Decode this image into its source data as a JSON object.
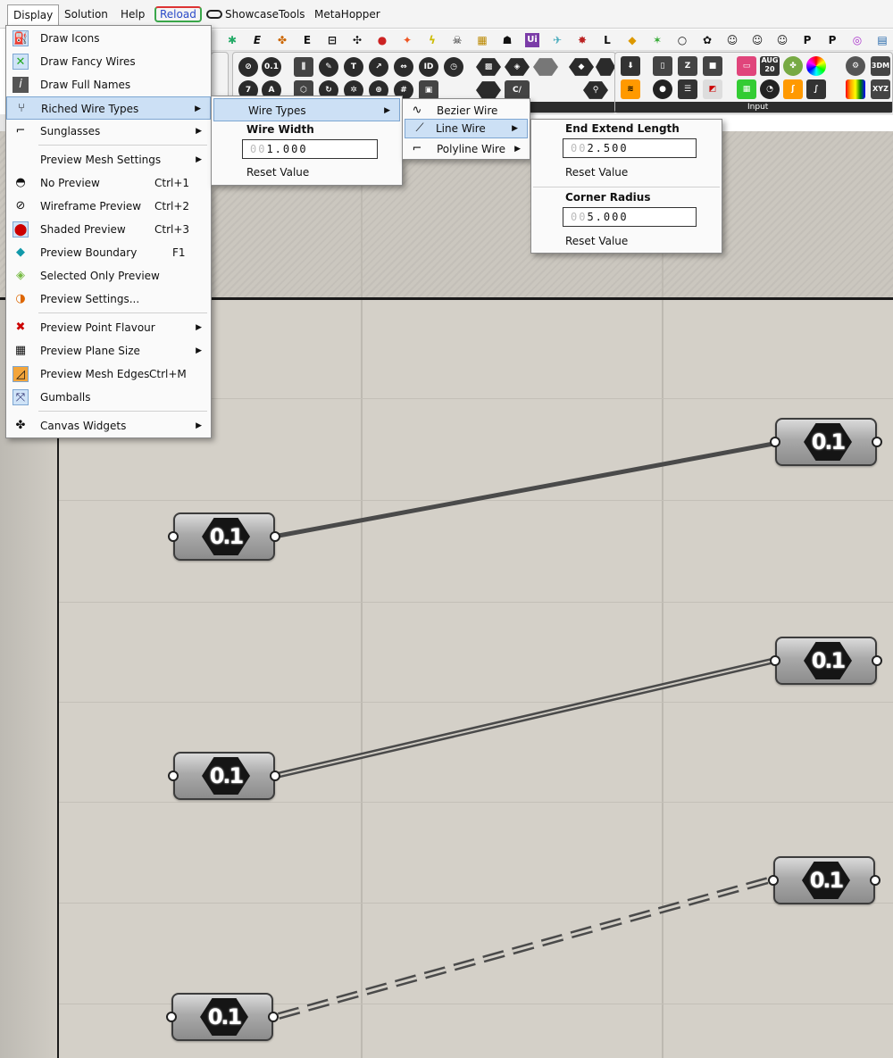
{
  "menubar": {
    "display": "Display",
    "solution": "Solution",
    "help": "Help",
    "reload": "Reload",
    "showcase": "ShowcaseTools",
    "metahopper": "MetaHopper"
  },
  "ribbon": {
    "input_label": "Input",
    "icon_labels": {
      "zero_one": "0.1",
      "seven": "7",
      "a": "A",
      "id": "ID",
      "c": "C/",
      "aug": "AUG",
      "twenty": "20",
      "three_dm": "3DM",
      "xyz": "XYZ",
      "ui": "Ui",
      "e": "E",
      "l": "L",
      "p": "P"
    }
  },
  "display_menu": {
    "items": [
      {
        "label": "Draw Icons"
      },
      {
        "label": "Draw Fancy Wires"
      },
      {
        "label": "Draw Full Names"
      },
      {
        "label": "Riched Wire Types"
      },
      {
        "label": "Sunglasses"
      },
      {
        "label": "Preview Mesh Settings"
      },
      {
        "label": "No Preview",
        "shortcut": "Ctrl+1"
      },
      {
        "label": "Wireframe Preview",
        "shortcut": "Ctrl+2"
      },
      {
        "label": "Shaded Preview",
        "shortcut": "Ctrl+3"
      },
      {
        "label": "Preview Boundary",
        "shortcut": "F1"
      },
      {
        "label": "Selected Only Preview"
      },
      {
        "label": "Preview Settings..."
      },
      {
        "label": "Preview Point Flavour"
      },
      {
        "label": "Preview Plane Size"
      },
      {
        "label": "Preview Mesh Edges",
        "shortcut": "Ctrl+M"
      },
      {
        "label": "Gumballs"
      },
      {
        "label": "Canvas Widgets"
      }
    ]
  },
  "wire_menu": {
    "wire_types": "Wire Types",
    "wire_width_title": "Wire Width",
    "wire_width_dim": "00",
    "wire_width_val": "1.000",
    "reset": "Reset Value"
  },
  "wire_types_menu": {
    "bezier": "Bezier Wire",
    "line": "Line Wire",
    "polyline": "Polyline Wire"
  },
  "line_menu": {
    "end_title": "End Extend Length",
    "end_dim": "00",
    "end_val": "2.500",
    "corner_title": "Corner Radius",
    "corner_dim": "00",
    "corner_val": "5.000",
    "reset": "Reset Value"
  },
  "nodes": {
    "label": "0.1"
  }
}
